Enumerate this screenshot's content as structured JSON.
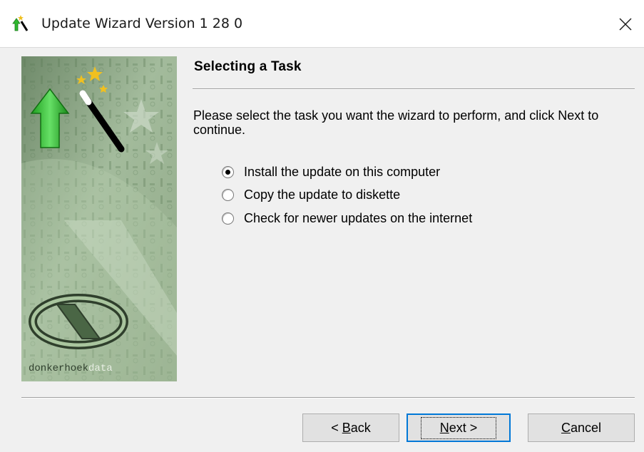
{
  "window": {
    "title": "Update Wizard Version 1 28 0"
  },
  "sidebar": {
    "brand_prefix": "donkerhoek",
    "brand_suffix": "data"
  },
  "page": {
    "heading": "Selecting a Task",
    "description": "Please select the task you want the wizard to perform, and click Next to continue."
  },
  "options": [
    {
      "label": "Install the update on this computer",
      "selected": true
    },
    {
      "label": "Copy the update to diskette",
      "selected": false
    },
    {
      "label": "Check for newer updates on the internet",
      "selected": false
    }
  ],
  "buttons": {
    "back": {
      "prefix": "< ",
      "mnemonic": "B",
      "rest": "ack"
    },
    "next": {
      "mnemonic": "N",
      "rest": "ext >"
    },
    "cancel": {
      "mnemonic": "C",
      "rest": "ancel"
    }
  },
  "colors": {
    "dialog_bg": "#f0f0f0",
    "arrow_green": "#3cc83c",
    "focus_blue": "#0078d7",
    "star_gold": "#f0c020"
  },
  "icons": {
    "app": "wizard-wand-icon",
    "close": "close-icon"
  }
}
